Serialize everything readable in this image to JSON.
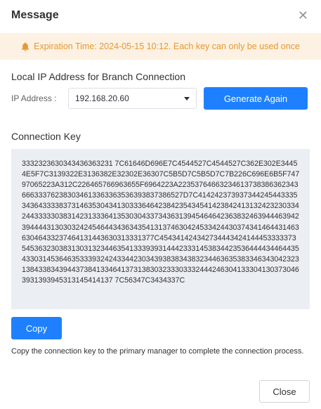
{
  "dialog": {
    "title": "Message",
    "close_icon": "close-icon"
  },
  "notice": {
    "icon": "bell-icon",
    "text": "Expiration Time: 2024-05-15 10:12. Each key can only be used once",
    "color": "#e6982e",
    "background": "#fdf1e3"
  },
  "ip_section": {
    "heading": "Local IP Address for Branch Connection",
    "field_label": "IP Address :",
    "selected_value": "192.168.20.60",
    "generate_label": "Generate Again"
  },
  "key_section": {
    "heading": "Connection Key",
    "key": "3332323630343436363231 7C61646D696E7C4544527C4544527C362E302E34454E5F7C3139322E3136382E32302E36307C5B5D7C5B5D7C7B226C696E6B5F74797065223A312C226465766963655F6964223A22353764663234613738386362343666333762383034613363363536393837386527D7C41424237393734424544333534364333383731463530434130333646423842354345414238424131324232303342443333303831423133364135303043373436313945464642363832463944463942394444313030324245464434363435413137463042453342443037434146443146363046433237464131443630313331377C4543414243427344434241444533333735453632303831303132344635413339393144423331453834423536444434464435433031453646353339324243344230343938383438323446363538334634304232313843383439443738413346413731383032333033324442463041333041303730463931393945313145414137 7C56347C3434337C",
    "copy_label": "Copy",
    "helper": "Copy the connection key to the primary manager to complete the connection process."
  },
  "footer": {
    "close_label": "Close"
  },
  "colors": {
    "primary": "#1e80ff",
    "key_background": "#ebeef2"
  }
}
